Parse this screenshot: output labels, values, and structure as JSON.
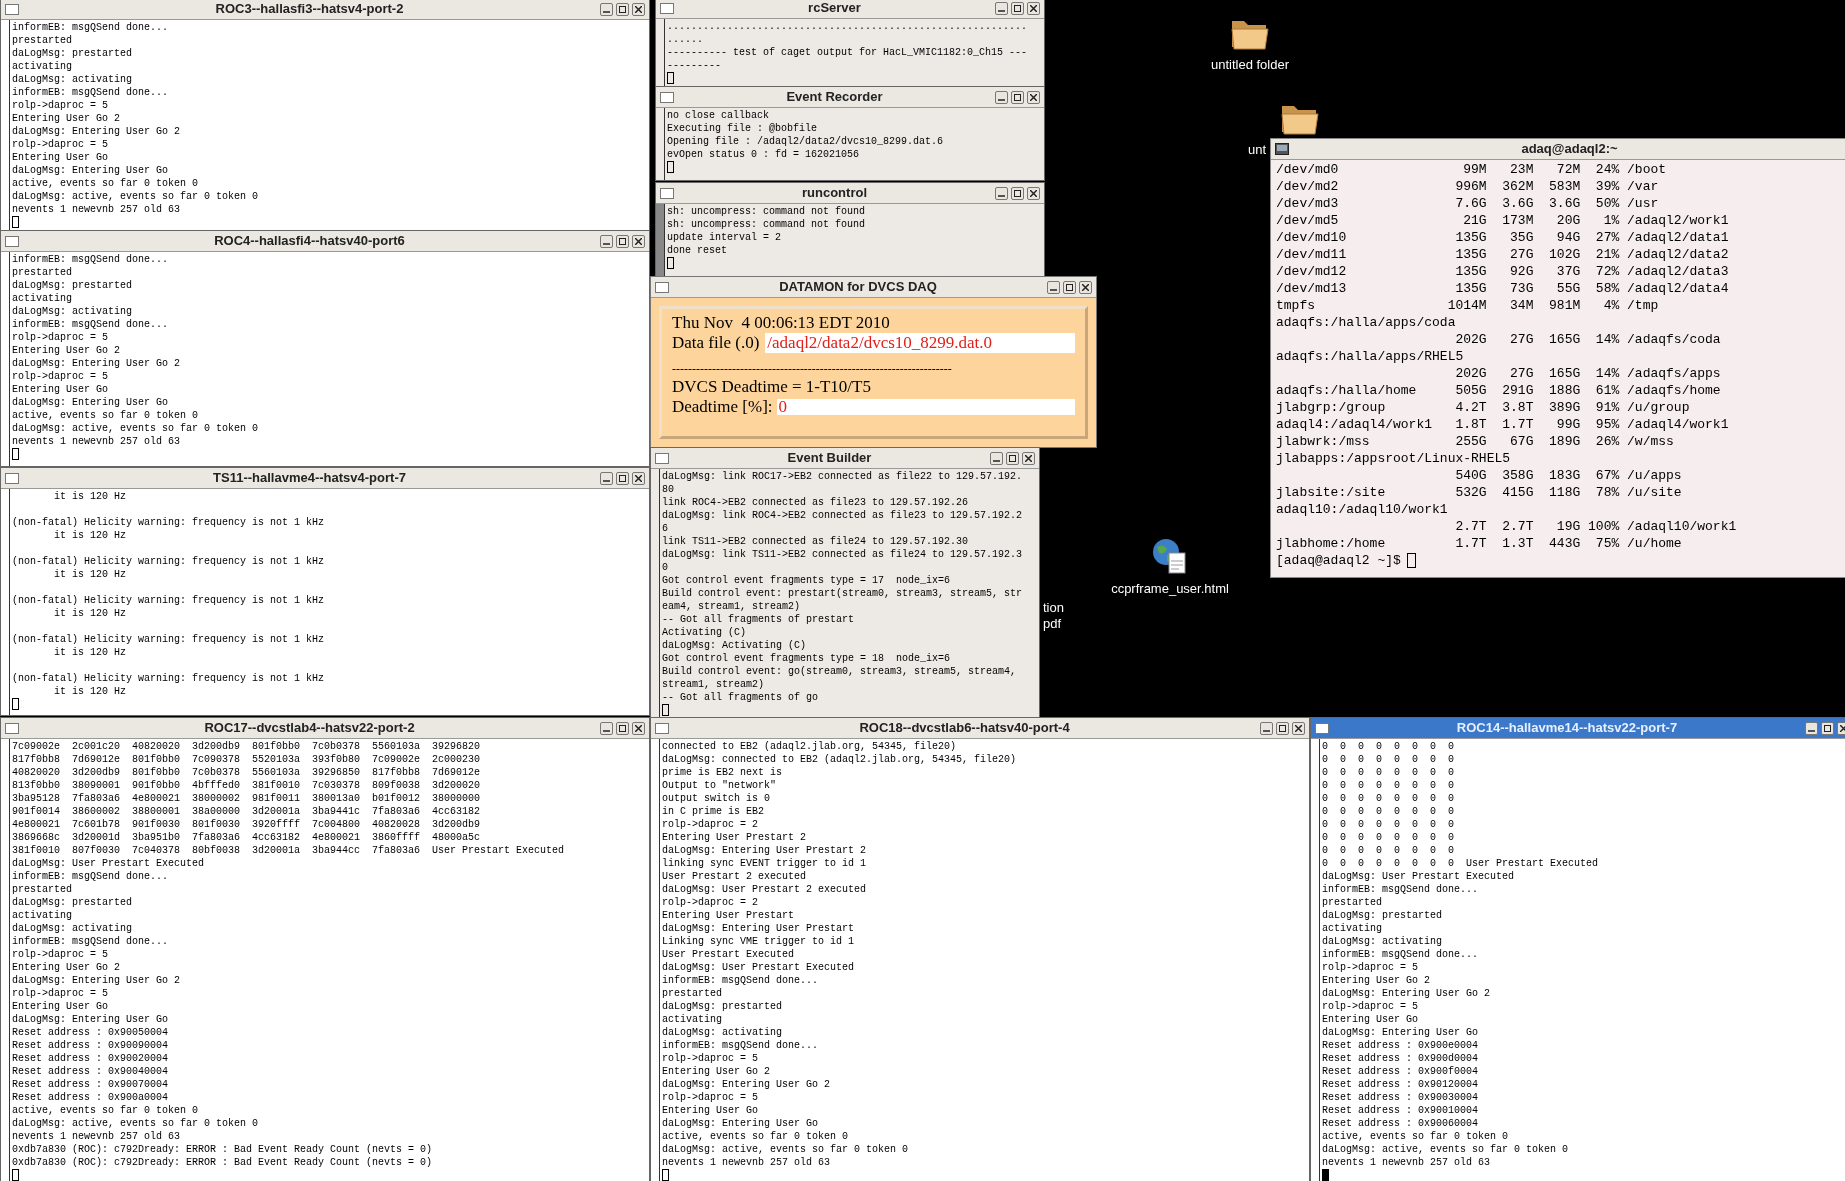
{
  "desktop_items": [
    {
      "kind": "folder",
      "label": "untitled folder"
    },
    {
      "kind": "folder",
      "label": "unt"
    },
    {
      "kind": "html",
      "label": "ccprframe_user.html"
    },
    {
      "kind": "text",
      "lines": [
        "tion",
        "pdf"
      ]
    }
  ],
  "windows": [
    {
      "kind": "xterm",
      "title": "ROC3--hallasfi3--hatsv4-port-2",
      "focused": false,
      "lines": [
        "informEB: msgQSend done...",
        "prestarted",
        "daLogMsg: prestarted",
        "activating",
        "daLogMsg: activating",
        "informEB: msgQSend done...",
        "rolp->daproc = 5",
        "Entering User Go 2",
        "daLogMsg: Entering User Go 2",
        "rolp->daproc = 5",
        "Entering User Go",
        "daLogMsg: Entering User Go",
        "active, events so far 0 token 0",
        "daLogMsg: active, events so far 0 token 0",
        "nevents 1 newevnb 257 old 63"
      ]
    },
    {
      "kind": "xterm",
      "title": "ROC4--hallasfi4--hatsv40-port6",
      "focused": false,
      "lines": [
        "informEB: msgQSend done...",
        "prestarted",
        "daLogMsg: prestarted",
        "activating",
        "daLogMsg: activating",
        "informEB: msgQSend done...",
        "rolp->daproc = 5",
        "Entering User Go 2",
        "daLogMsg: Entering User Go 2",
        "rolp->daproc = 5",
        "Entering User Go",
        "daLogMsg: Entering User Go",
        "active, events so far 0 token 0",
        "daLogMsg: active, events so far 0 token 0",
        "nevents 1 newevnb 257 old 63"
      ]
    },
    {
      "kind": "xterm",
      "title": "TS11--hallavme4--hatsv4-port-7",
      "focused": false,
      "blocks": [
        [
          "       it is 120 Hz"
        ],
        [
          "(non-fatal) Helicity warning: frequency is not 1 kHz",
          "       it is 120 Hz"
        ],
        [
          "(non-fatal) Helicity warning: frequency is not 1 kHz",
          "       it is 120 Hz"
        ],
        [
          "(non-fatal) Helicity warning: frequency is not 1 kHz",
          "       it is 120 Hz"
        ],
        [
          "(non-fatal) Helicity warning: frequency is not 1 kHz",
          "       it is 120 Hz"
        ],
        [
          "(non-fatal) Helicity warning: frequency is not 1 kHz",
          "       it is 120 Hz"
        ]
      ]
    },
    {
      "kind": "xterm",
      "title": "ROC17--dvcstlab4--hatsv22-port-2",
      "focused": false,
      "lines": [
        "7c09002e  2c001c20  40820020  3d200db9  801f0bb0  7c0b0378  5560103a  39296820",
        "817f0bb8  7d69012e  801f0bb0  7c090378  5520103a  393f0b80  7c09002e  2c000230",
        "40820020  3d200db9  801f0bb0  7c0b0378  5560103a  39296850  817f0bb8  7d69012e",
        "813f0bb0  38090001  901f0bb0  4bfffed0  381f0010  7c030378  809f0038  3d200020",
        "3ba95128  7fa803a6  4e800021  38000002  981f0011  380013a0  b01f0012  38000000",
        "901f0014  38600002  38800001  38a00000  3d20001a  3ba9441c  7fa803a6  4cc63182",
        "4e800021  7c601b78  901f0030  801f0030  3920ffff  7c004800  40820028  3d200db9",
        "3869668c  3d20001d  3ba951b0  7fa803a6  4cc63182  4e800021  3860ffff  48000a5c",
        "381f0010  807f0030  7c040378  80bf0038  3d20001a  3ba944cc  7fa803a6  User Prestart Executed",
        "daLogMsg: User Prestart Executed",
        "informEB: msgQSend done...",
        "prestarted",
        "daLogMsg: prestarted",
        "activating",
        "daLogMsg: activating",
        "informEB: msgQSend done...",
        "rolp->daproc = 5",
        "Entering User Go 2",
        "daLogMsg: Entering User Go 2",
        "rolp->daproc = 5",
        "Entering User Go",
        "daLogMsg: Entering User Go",
        "Reset address : 0x90050004",
        "Reset address : 0x90090004",
        "Reset address : 0x90020004",
        "Reset address : 0x90040004",
        "Reset address : 0x90070004",
        "Reset address : 0x900a0004",
        "active, events so far 0 token 0",
        "daLogMsg: active, events so far 0 token 0",
        "nevents 1 newevnb 257 old 63",
        "0xdb7a830 (ROC): c792Dready: ERROR : Bad Event Ready Count (nevts = 0)",
        "0xdb7a830 (ROC): c792Dready: ERROR : Bad Event Ready Count (nevts = 0)"
      ]
    },
    {
      "kind": "console",
      "title": "rcServer",
      "focused": false,
      "lines": [
        "............................................................",
        "......",
        "---------- test of caget output for HacL_VMIC1182:0_Ch15 ---",
        "---------"
      ]
    },
    {
      "kind": "console",
      "title": "Event Recorder",
      "focused": false,
      "lines": [
        "no close callback",
        "Executing file : @bobfile",
        "Opening file : /adaql2/data2/dvcs10_8299.dat.6",
        "evOpen status 0 : fd = 162021056"
      ]
    },
    {
      "kind": "console",
      "title": "runcontrol",
      "focused": false,
      "lines": [
        "sh: uncompress: command not found",
        "sh: uncompress: command not found",
        "update interval = 2",
        "done reset"
      ]
    },
    {
      "kind": "datamon",
      "title": "DATAMON  for DVCS DAQ",
      "focused": false,
      "date": "Thu Nov  4 00:06:13 EDT 2010",
      "file_label": "Data file (.0)",
      "file_value": "/adaql2/data2/dvcs10_8299.dat.0",
      "rule": "----------------------------------------------------------------------",
      "formula": "DVCS Deadtime = 1-T10/T5",
      "deadtime_label": "Deadtime [%]:",
      "deadtime_value": "0"
    },
    {
      "kind": "console",
      "title": "Event Builder",
      "focused": false,
      "lines": [
        "daLogMsg: link ROC17->EB2 connected as file22 to 129.57.192.",
        "80",
        "link ROC4->EB2 connected as file23 to 129.57.192.26",
        "daLogMsg: link ROC4->EB2 connected as file23 to 129.57.192.2",
        "6",
        "link TS11->EB2 connected as file24 to 129.57.192.30",
        "daLogMsg: link TS11->EB2 connected as file24 to 129.57.192.3",
        "0",
        "Got control event fragments type = 17  node_ix=6",
        "Build control event: prestart(stream0, stream3, stream5, str",
        "eam4, stream1, stream2)",
        "-- Got all fragments of prestart",
        "Activating (C)",
        "daLogMsg: Activating (C)",
        "Got control event fragments type = 18  node_ix=6",
        "Build control event: go(stream0, stream3, stream5, stream4,",
        "stream1, stream2)",
        "-- Got all fragments of go"
      ]
    },
    {
      "kind": "shell",
      "title": "adaq@adaql2:~",
      "focused": false,
      "lines": [
        "/dev/md0                99M   23M   72M  24% /boot",
        "/dev/md2               996M  362M  583M  39% /var",
        "/dev/md3               7.6G  3.6G  3.6G  50% /usr",
        "/dev/md5                21G  173M   20G   1% /adaql2/work1",
        "/dev/md10              135G   35G   94G  27% /adaql2/data1",
        "/dev/md11              135G   27G  102G  21% /adaql2/data2",
        "/dev/md12              135G   92G   37G  72% /adaql2/data3",
        "/dev/md13              135G   73G   55G  58% /adaql2/data4",
        "tmpfs                 1014M   34M  981M   4% /tmp",
        "adaqfs:/halla/apps/coda",
        "                       202G   27G  165G  14% /adaqfs/coda",
        "adaqfs:/halla/apps/RHEL5",
        "                       202G   27G  165G  14% /adaqfs/apps",
        "adaqfs:/halla/home     505G  291G  188G  61% /adaqfs/home",
        "jlabgrp:/group         4.2T  3.8T  389G  91% /u/group",
        "adaql4:/adaql4/work1   1.8T  1.7T   99G  95% /adaql4/work1",
        "jlabwrk:/mss           255G   67G  189G  26% /w/mss",
        "jlabapps:/appsroot/Linux-RHEL5",
        "                       540G  358G  183G  67% /u/apps",
        "jlabsite:/site         532G  415G  118G  78% /u/site",
        "adaql10:/adaql10/work1",
        "                       2.7T  2.7T   19G 100% /adaql10/work1",
        "jlabhome:/home         1.7T  1.3T  443G  75% /u/home"
      ],
      "prompt": "[adaq@adaql2 ~]$"
    },
    {
      "kind": "xterm",
      "title": "ROC18--dvcstlab6--hatsv40-port-4",
      "focused": false,
      "lines": [
        "connected to EB2 (adaql2.jlab.org, 54345, file20)",
        "daLogMsg: connected to EB2 (adaql2.jlab.org, 54345, file20)",
        "prime is EB2 next is",
        "Output to \"network\"",
        "output switch is 0",
        "in C prime is EB2",
        "rolp->daproc = 2",
        "Entering User Prestart 2",
        "daLogMsg: Entering User Prestart 2",
        "linking sync EVENT trigger to id 1",
        "User Prestart 2 executed",
        "daLogMsg: User Prestart 2 executed",
        "rolp->daproc = 2",
        "Entering User Prestart",
        "daLogMsg: Entering User Prestart",
        "Linking sync VME trigger to id 1",
        "User Prestart Executed",
        "daLogMsg: User Prestart Executed",
        "informEB: msgQSend done...",
        "prestarted",
        "daLogMsg: prestarted",
        "activating",
        "daLogMsg: activating",
        "informEB: msgQSend done...",
        "rolp->daproc = 5",
        "Entering User Go 2",
        "daLogMsg: Entering User Go 2",
        "rolp->daproc = 5",
        "Entering User Go",
        "daLogMsg: Entering User Go",
        "active, events so far 0 token 0",
        "daLogMsg: active, events so far 0 token 0",
        "nevents 1 newevnb 257 old 63"
      ]
    },
    {
      "kind": "xterm",
      "title": "ROC14--hallavme14--hatsv22-port-7",
      "focused": true,
      "lines": [
        "0  0  0  0  0  0  0  0",
        "0  0  0  0  0  0  0  0",
        "0  0  0  0  0  0  0  0",
        "0  0  0  0  0  0  0  0",
        "0  0  0  0  0  0  0  0",
        "0  0  0  0  0  0  0  0",
        "0  0  0  0  0  0  0  0",
        "0  0  0  0  0  0  0  0",
        "0  0  0  0  0  0  0  0",
        "0  0  0  0  0  0  0  0  User Prestart Executed",
        "daLogMsg: User Prestart Executed",
        "informEB: msgQSend done...",
        "prestarted",
        "daLogMsg: prestarted",
        "activating",
        "daLogMsg: activating",
        "informEB: msgQSend done...",
        "rolp->daproc = 5",
        "Entering User Go 2",
        "daLogMsg: Entering User Go 2",
        "rolp->daproc = 5",
        "Entering User Go",
        "daLogMsg: Entering User Go",
        "Reset address : 0x900e0004",
        "Reset address : 0x900d0004",
        "Reset address : 0x900f0004",
        "Reset address : 0x90120004",
        "Reset address : 0x90030004",
        "Reset address : 0x90010004",
        "Reset address : 0x90060004",
        "active, events so far 0 token 0",
        "daLogMsg: active, events so far 0 token 0",
        "nevents 1 newevnb 257 old 63"
      ]
    }
  ]
}
